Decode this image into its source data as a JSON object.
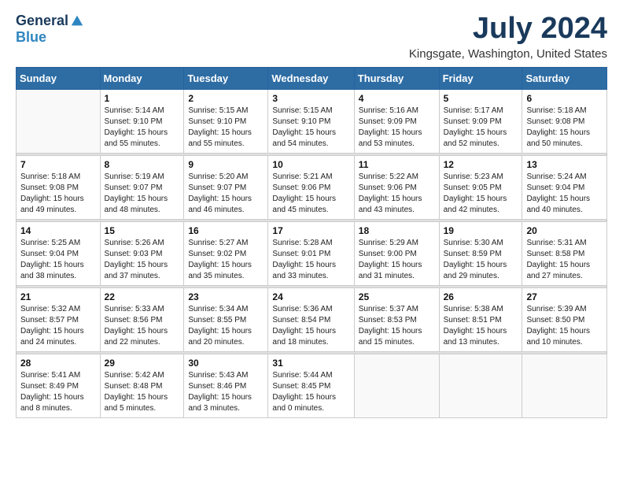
{
  "logo": {
    "general": "General",
    "blue": "Blue"
  },
  "title": "July 2024",
  "location": "Kingsgate, Washington, United States",
  "headers": [
    "Sunday",
    "Monday",
    "Tuesday",
    "Wednesday",
    "Thursday",
    "Friday",
    "Saturday"
  ],
  "weeks": [
    [
      {
        "day": "",
        "info": ""
      },
      {
        "day": "1",
        "info": "Sunrise: 5:14 AM\nSunset: 9:10 PM\nDaylight: 15 hours\nand 55 minutes."
      },
      {
        "day": "2",
        "info": "Sunrise: 5:15 AM\nSunset: 9:10 PM\nDaylight: 15 hours\nand 55 minutes."
      },
      {
        "day": "3",
        "info": "Sunrise: 5:15 AM\nSunset: 9:10 PM\nDaylight: 15 hours\nand 54 minutes."
      },
      {
        "day": "4",
        "info": "Sunrise: 5:16 AM\nSunset: 9:09 PM\nDaylight: 15 hours\nand 53 minutes."
      },
      {
        "day": "5",
        "info": "Sunrise: 5:17 AM\nSunset: 9:09 PM\nDaylight: 15 hours\nand 52 minutes."
      },
      {
        "day": "6",
        "info": "Sunrise: 5:18 AM\nSunset: 9:08 PM\nDaylight: 15 hours\nand 50 minutes."
      }
    ],
    [
      {
        "day": "7",
        "info": "Sunrise: 5:18 AM\nSunset: 9:08 PM\nDaylight: 15 hours\nand 49 minutes."
      },
      {
        "day": "8",
        "info": "Sunrise: 5:19 AM\nSunset: 9:07 PM\nDaylight: 15 hours\nand 48 minutes."
      },
      {
        "day": "9",
        "info": "Sunrise: 5:20 AM\nSunset: 9:07 PM\nDaylight: 15 hours\nand 46 minutes."
      },
      {
        "day": "10",
        "info": "Sunrise: 5:21 AM\nSunset: 9:06 PM\nDaylight: 15 hours\nand 45 minutes."
      },
      {
        "day": "11",
        "info": "Sunrise: 5:22 AM\nSunset: 9:06 PM\nDaylight: 15 hours\nand 43 minutes."
      },
      {
        "day": "12",
        "info": "Sunrise: 5:23 AM\nSunset: 9:05 PM\nDaylight: 15 hours\nand 42 minutes."
      },
      {
        "day": "13",
        "info": "Sunrise: 5:24 AM\nSunset: 9:04 PM\nDaylight: 15 hours\nand 40 minutes."
      }
    ],
    [
      {
        "day": "14",
        "info": "Sunrise: 5:25 AM\nSunset: 9:04 PM\nDaylight: 15 hours\nand 38 minutes."
      },
      {
        "day": "15",
        "info": "Sunrise: 5:26 AM\nSunset: 9:03 PM\nDaylight: 15 hours\nand 37 minutes."
      },
      {
        "day": "16",
        "info": "Sunrise: 5:27 AM\nSunset: 9:02 PM\nDaylight: 15 hours\nand 35 minutes."
      },
      {
        "day": "17",
        "info": "Sunrise: 5:28 AM\nSunset: 9:01 PM\nDaylight: 15 hours\nand 33 minutes."
      },
      {
        "day": "18",
        "info": "Sunrise: 5:29 AM\nSunset: 9:00 PM\nDaylight: 15 hours\nand 31 minutes."
      },
      {
        "day": "19",
        "info": "Sunrise: 5:30 AM\nSunset: 8:59 PM\nDaylight: 15 hours\nand 29 minutes."
      },
      {
        "day": "20",
        "info": "Sunrise: 5:31 AM\nSunset: 8:58 PM\nDaylight: 15 hours\nand 27 minutes."
      }
    ],
    [
      {
        "day": "21",
        "info": "Sunrise: 5:32 AM\nSunset: 8:57 PM\nDaylight: 15 hours\nand 24 minutes."
      },
      {
        "day": "22",
        "info": "Sunrise: 5:33 AM\nSunset: 8:56 PM\nDaylight: 15 hours\nand 22 minutes."
      },
      {
        "day": "23",
        "info": "Sunrise: 5:34 AM\nSunset: 8:55 PM\nDaylight: 15 hours\nand 20 minutes."
      },
      {
        "day": "24",
        "info": "Sunrise: 5:36 AM\nSunset: 8:54 PM\nDaylight: 15 hours\nand 18 minutes."
      },
      {
        "day": "25",
        "info": "Sunrise: 5:37 AM\nSunset: 8:53 PM\nDaylight: 15 hours\nand 15 minutes."
      },
      {
        "day": "26",
        "info": "Sunrise: 5:38 AM\nSunset: 8:51 PM\nDaylight: 15 hours\nand 13 minutes."
      },
      {
        "day": "27",
        "info": "Sunrise: 5:39 AM\nSunset: 8:50 PM\nDaylight: 15 hours\nand 10 minutes."
      }
    ],
    [
      {
        "day": "28",
        "info": "Sunrise: 5:41 AM\nSunset: 8:49 PM\nDaylight: 15 hours\nand 8 minutes."
      },
      {
        "day": "29",
        "info": "Sunrise: 5:42 AM\nSunset: 8:48 PM\nDaylight: 15 hours\nand 5 minutes."
      },
      {
        "day": "30",
        "info": "Sunrise: 5:43 AM\nSunset: 8:46 PM\nDaylight: 15 hours\nand 3 minutes."
      },
      {
        "day": "31",
        "info": "Sunrise: 5:44 AM\nSunset: 8:45 PM\nDaylight: 15 hours\nand 0 minutes."
      },
      {
        "day": "",
        "info": ""
      },
      {
        "day": "",
        "info": ""
      },
      {
        "day": "",
        "info": ""
      }
    ]
  ]
}
